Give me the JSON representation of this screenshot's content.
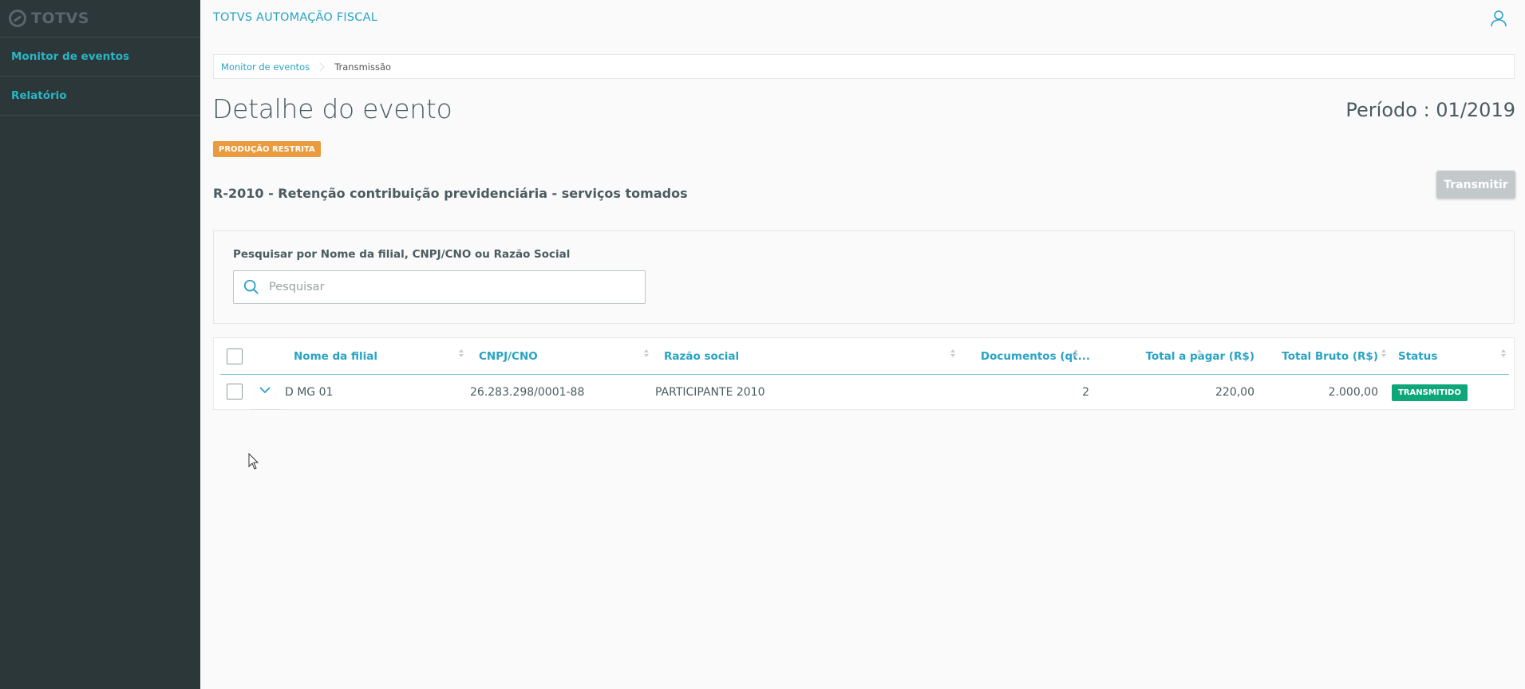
{
  "sidebar": {
    "logo_text": "TOTVS",
    "items": [
      {
        "label": "Monitor de eventos"
      },
      {
        "label": "Relatório"
      }
    ]
  },
  "header": {
    "app_title": "TOTVS AUTOMAÇÃO FISCAL"
  },
  "breadcrumb": {
    "items": [
      {
        "label": "Monitor de eventos"
      },
      {
        "label": "Transmissão"
      }
    ]
  },
  "page": {
    "title": "Detalhe do evento",
    "periodo": "Período : 01/2019",
    "environment_badge": "PRODUÇÃO RESTRITA",
    "event_title": "R-2010 - Retenção contribuição previdenciária - serviços tomados",
    "transmit_button": "Transmitir"
  },
  "search": {
    "label": "Pesquisar por Nome da filial, CNPJ/CNO ou Razão Social",
    "placeholder": "Pesquisar",
    "value": ""
  },
  "table": {
    "columns": [
      {
        "label": "Nome da filial"
      },
      {
        "label": "CNPJ/CNO"
      },
      {
        "label": "Razão social"
      },
      {
        "label": "Documentos (qt..."
      },
      {
        "label": "Total a pagar (R$)"
      },
      {
        "label": "Total Bruto (R$)"
      },
      {
        "label": "Status"
      }
    ],
    "rows": [
      {
        "nome_filial": "D MG 01",
        "cnpj": "26.283.298/0001-88",
        "razao_social": "PARTICIPANTE 2010",
        "documentos": "2",
        "total_pagar": "220,00",
        "total_bruto": "2.000,00",
        "status": "TRANSMITIDO"
      }
    ]
  },
  "colors": {
    "sidebar_bg": "#2c3739",
    "accent": "#29a3c4",
    "badge_env": "#ea9b3e",
    "status_ok": "#0fa77a"
  }
}
